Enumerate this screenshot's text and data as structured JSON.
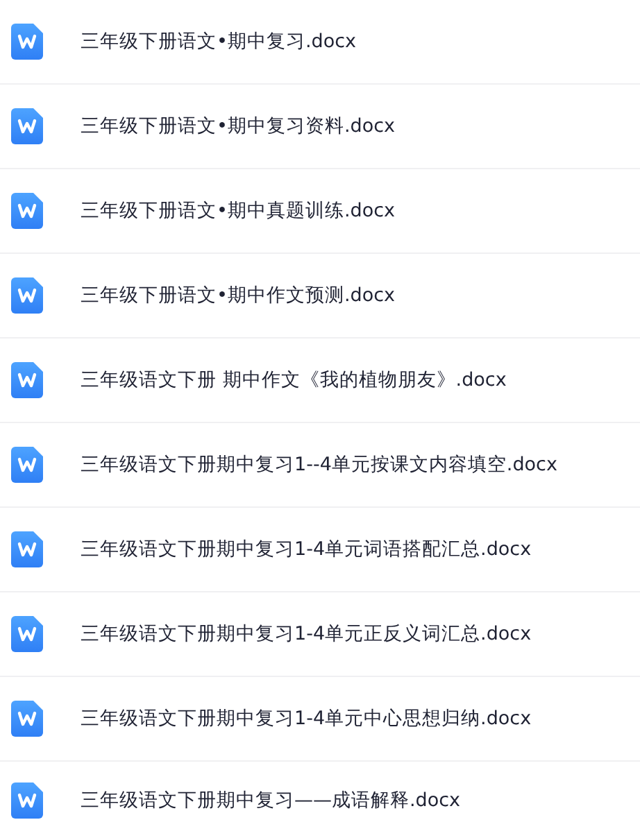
{
  "files": [
    {
      "name": "三年级下册语文•期中复习.docx"
    },
    {
      "name": "三年级下册语文•期中复习资料.docx"
    },
    {
      "name": "三年级下册语文•期中真题训练.docx"
    },
    {
      "name": "三年级下册语文•期中作文预测.docx"
    },
    {
      "name": "三年级语文下册 期中作文《我的植物朋友》.docx"
    },
    {
      "name": "三年级语文下册期中复习1--4单元按课文内容填空.docx"
    },
    {
      "name": "三年级语文下册期中复习1-4单元词语搭配汇总.docx"
    },
    {
      "name": "三年级语文下册期中复习1-4单元正反义词汇总.docx"
    },
    {
      "name": "三年级语文下册期中复习1-4单元中心思想归纳.docx"
    },
    {
      "name": "三年级语文下册期中复习——成语解释.docx"
    }
  ]
}
